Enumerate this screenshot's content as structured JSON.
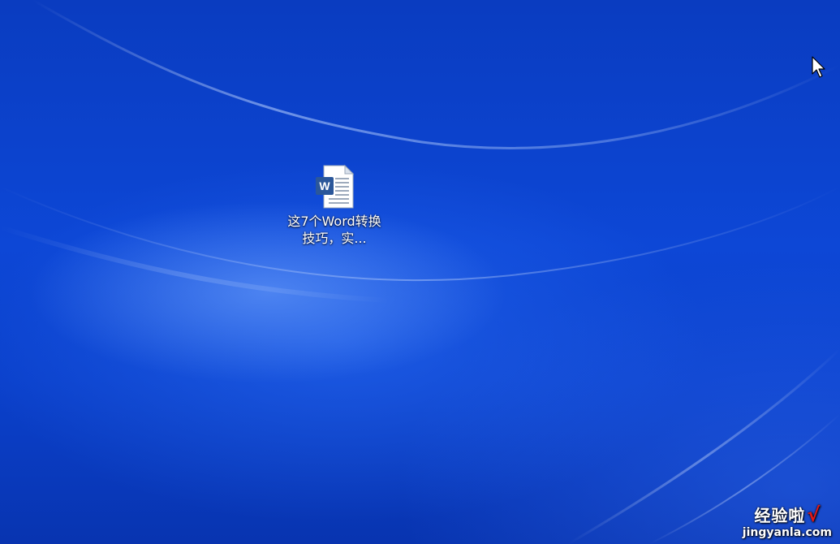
{
  "desktop": {
    "icons": [
      {
        "label": "这7个Word转换技巧，实...",
        "icon": "word-document-icon"
      }
    ]
  },
  "watermark": {
    "title": "经验啦",
    "check": "√",
    "url": "jingyanla.com"
  },
  "colors": {
    "wallpaper_base": "#0b3fc4",
    "word_blue": "#2b579a",
    "watermark_check": "#e01818"
  },
  "cursor": {
    "icon": "arrow-cursor-icon"
  }
}
